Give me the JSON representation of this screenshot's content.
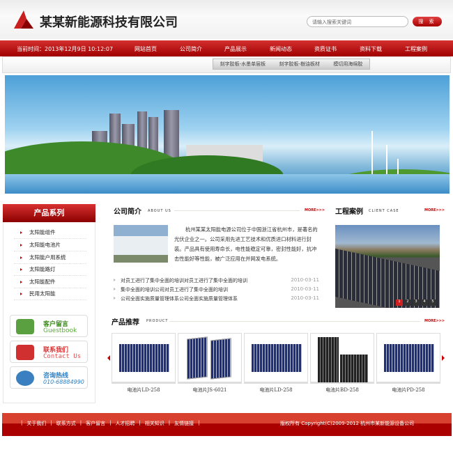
{
  "header": {
    "title": "某某新能源科技有限公司",
    "search_placeholder": "请输入搜索关键词",
    "search_button": "搜 索"
  },
  "nav": {
    "datetime": "当前时间：2013年12月9日  10:12:07",
    "items": [
      "网站首页",
      "公司简介",
      "产品展示",
      "新闻动态",
      "资质证书",
      "资料下载",
      "工程案例"
    ],
    "active": "产品展示",
    "submenu": [
      "刻字胶板-水墨单层板",
      "刻字胶板-樹油板材",
      "模切用海绵胶"
    ]
  },
  "sidebar": {
    "title": "产品系列",
    "items": [
      "太阳能组件",
      "太阳能电池片",
      "太阳能户用系统",
      "太阳能路灯",
      "太阳能配件",
      "民用太阳能"
    ],
    "buttons": [
      {
        "cn": "客户留言",
        "en": "Guestbook",
        "color": "#4a9a2a"
      },
      {
        "cn": "联系我们",
        "en": "Contact Us",
        "color": "#e04040"
      },
      {
        "cn": "咨询热线",
        "en": "010-68884990",
        "color": "#2a8ad0"
      }
    ]
  },
  "about": {
    "title": "公司简介",
    "en": "ABOUT US",
    "more": "MORE>>>",
    "text": "杭州某某太阳能电源公司位于中国浙江省杭州市，是著名的光伏企业之一。公司采用先进工艺技术和优质进口材料进行封装。产品具有使用寿命长，电性能稳定可靠，密封性能好，抗冲击性能好等性能，被广泛应用在并网发电系统。",
    "news": [
      {
        "title": "对员工进行了集中全面的培训对员工进行了集中全面的培训",
        "date": "2010-03-11"
      },
      {
        "title": "集中全面的培训公司对员工进行了集中全面的培训",
        "date": "2010-03-11"
      },
      {
        "title": "公司全面实施质量管理体系公司全面实施质量管理体系",
        "date": "2010-03-11"
      }
    ]
  },
  "cases": {
    "title": "工程案例",
    "en": "CLIENT CASE",
    "more": "MORE>>>",
    "slides": [
      "1",
      "2",
      "3",
      "4",
      "5"
    ],
    "active_slide": 1
  },
  "products": {
    "title": "产品推荐",
    "en": "PRODUCT",
    "more": "MORE>>>",
    "items": [
      "电池片LD-258",
      "电池片JS-6021",
      "电池片LD-258",
      "电池片BD-258",
      "电池片PD-258"
    ]
  },
  "footer": {
    "links": [
      "关于我们",
      "联系方式",
      "客户留言",
      "人才招聘",
      "相关知识",
      "友情链接"
    ],
    "copyright": "版权所有  Copyright(C)2009-2012 杭州市某新能源设备公司"
  },
  "colors": {
    "brand_red": "#b00000"
  }
}
